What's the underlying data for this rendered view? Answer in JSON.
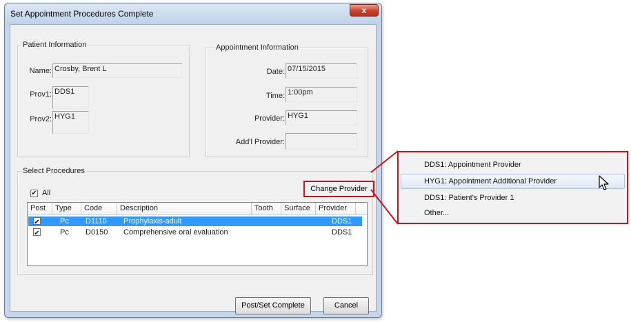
{
  "window": {
    "title": "Set Appointment Procedures Complete",
    "close_glyph": "x"
  },
  "patient": {
    "group_label": "Patient Information",
    "name_label": "Name:",
    "name_value": "Crosby, Brent L",
    "prov1_label": "Prov1:",
    "prov1_value": "DDS1",
    "prov2_label": "Prov2:",
    "prov2_value": "HYG1"
  },
  "appointment": {
    "group_label": "Appointment Information",
    "date_label": "Date:",
    "date_value": "07/15/2015",
    "time_label": "Time:",
    "time_value": "1:00pm",
    "provider_label": "Provider:",
    "provider_value": "HYG1",
    "addl_label": "Add'l Provider:",
    "addl_value": ""
  },
  "procedures": {
    "group_label": "Select Procedures",
    "all_label": "All",
    "all_checked": "✔",
    "change_provider_label": "Change Provider",
    "columns": [
      "Post",
      "Type",
      "Code",
      "Description",
      "Tooth",
      "Surface",
      "Provider"
    ],
    "rows": [
      {
        "post": "✔",
        "type": "Pc",
        "code": "D1110",
        "description": "Prophylaxis-adult",
        "tooth": "",
        "surface": "",
        "provider": "DDS1"
      },
      {
        "post": "✔",
        "type": "Pc",
        "code": "D0150",
        "description": "Comprehensive oral evaluation",
        "tooth": "",
        "surface": "",
        "provider": "DDS1"
      }
    ]
  },
  "buttons": {
    "post_label": "Post/Set Complete",
    "cancel_label": "Cancel"
  },
  "popup_menu": {
    "items": [
      "DDS1: Appointment Provider",
      "HYG1: Appointment Additional Provider",
      "DDS1: Patient's Provider 1",
      "Other..."
    ]
  },
  "colors": {
    "highlight": "#c4161c",
    "selection": "#3399ff"
  }
}
